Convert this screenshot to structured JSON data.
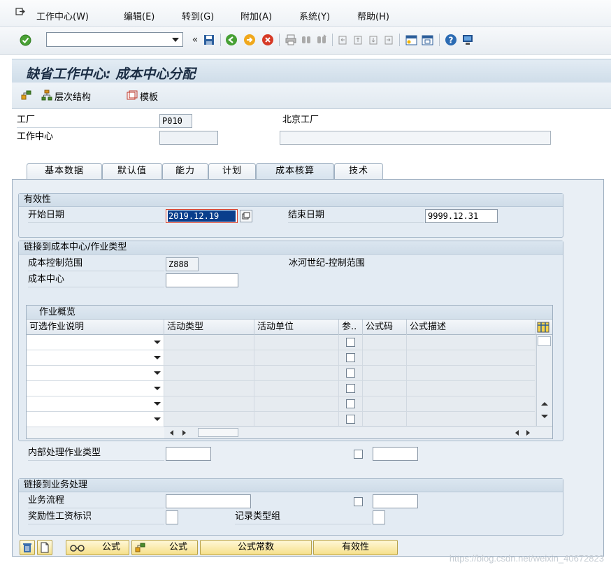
{
  "menu": {
    "items": [
      "工作中心(W)",
      "编辑(E)",
      "转到(G)",
      "附加(A)",
      "系统(Y)",
      "帮助(H)"
    ]
  },
  "toolbar": {
    "command_value": "",
    "icons": [
      "check-icon",
      "back-arrows-icon",
      "save-icon",
      "green-back-icon",
      "exit-icon",
      "cancel-icon",
      "print-icon",
      "find-icon",
      "find-next-icon",
      "first-page-icon",
      "prev-page-icon",
      "next-page-icon",
      "last-page-icon",
      "new-session-icon",
      "shortcut-icon",
      "help-icon",
      "layout-icon"
    ]
  },
  "title": "缺省工作中心: 成本中心分配",
  "app_toolbar": {
    "hierarchy_label": "层次结构",
    "template_label": "模板"
  },
  "header": {
    "plant_label": "工厂",
    "plant_value": "P010",
    "plant_desc": "北京工厂",
    "workcenter_label": "工作中心",
    "workcenter_value": "",
    "workcenter_desc": ""
  },
  "tabs": [
    "基本数据",
    "默认值",
    "能力",
    "计划",
    "成本核算",
    "技术"
  ],
  "active_tab": "成本核算",
  "validity": {
    "title": "有效性",
    "start_label": "开始日期",
    "start_value": "2019.12.19",
    "end_label": "结束日期",
    "end_value": "9999.12.31"
  },
  "link_cc": {
    "title": "链接到成本中心/作业类型",
    "ca_label": "成本控制范围",
    "ca_value": "Z888",
    "ca_desc": "冰河世纪-控制范围",
    "cc_label": "成本中心",
    "cc_value": ""
  },
  "activity_table": {
    "title": "作业概览",
    "columns": [
      "可选作业说明",
      "活动类型",
      "活动单位",
      "参..",
      "公式码",
      "公式描述"
    ],
    "row_count": 6
  },
  "internal_processing": {
    "label": "内部处理作业类型",
    "value": "",
    "extra_value": ""
  },
  "link_bp": {
    "title": "链接到业务处理",
    "process_label": "业务流程",
    "process_value": "",
    "process_extra": "",
    "incentive_label": "奖励性工资标识",
    "record_type_label": "记录类型组"
  },
  "buttons": {
    "formula1": "公式",
    "formula2": "公式",
    "formula_const": "公式常数",
    "validity": "有效性"
  },
  "watermark": "https://blog.csdn.net/weixin_40672823"
}
